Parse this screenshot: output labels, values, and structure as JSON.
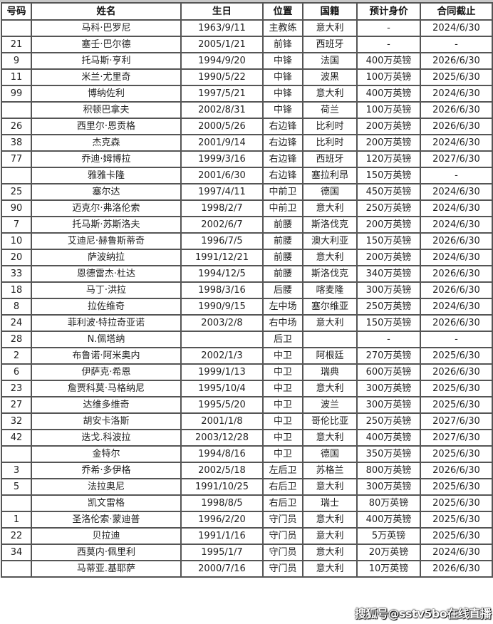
{
  "table": {
    "headers": [
      "号码",
      "姓名",
      "生日",
      "位置",
      "国籍",
      "预计身价",
      "合同截止"
    ],
    "rows": [
      [
        "",
        "马科·巴罗尼",
        "1963/9/11",
        "主教练",
        "意大利",
        "-",
        "2024/6/30"
      ],
      [
        "21",
        "塞壬·巴尔德",
        "2005/1/21",
        "前锋",
        "西班牙",
        "-",
        "-"
      ],
      [
        "9",
        "托马斯·亨利",
        "1994/9/20",
        "中锋",
        "法国",
        "400万英镑",
        "2026/6/30"
      ],
      [
        "11",
        "米兰·尤里奇",
        "1990/5/22",
        "中锋",
        "波黑",
        "100万英镑",
        "2025/6/30"
      ],
      [
        "99",
        "博纳佐利",
        "1997/5/21",
        "中锋",
        "意大利",
        "400万英镑",
        "2024/6/30"
      ],
      [
        "",
        "积顿巴拿夫",
        "2002/8/31",
        "中锋",
        "荷兰",
        "100万英镑",
        "2026/6/30"
      ],
      [
        "26",
        "西里尔·恩贡格",
        "2000/5/26",
        "右边锋",
        "比利时",
        "200万英镑",
        "2026/6/30"
      ],
      [
        "38",
        "杰克森",
        "2001/9/14",
        "右边锋",
        "比利时",
        "200万英镑",
        "2024/6/30"
      ],
      [
        "77",
        "乔迪·姆博拉",
        "1999/3/16",
        "右边锋",
        "西班牙",
        "120万英镑",
        "2027/6/30"
      ],
      [
        "",
        "雅雅卡隆",
        "2001/6/30",
        "右边锋",
        "塞拉利昂",
        "150万英镑",
        "-"
      ],
      [
        "25",
        "塞尔达",
        "1997/4/11",
        "中前卫",
        "德国",
        "450万英镑",
        "2024/6/30"
      ],
      [
        "90",
        "迈克尔·弗洛伦索",
        "1998/2/7",
        "中前卫",
        "意大利",
        "250万英镑",
        "2024/6/30"
      ],
      [
        "7",
        "托马斯·苏斯洛夫",
        "2002/6/7",
        "前腰",
        "斯洛伐克",
        "200万英镑",
        "2024/6/30"
      ],
      [
        "10",
        "艾迪尼·赫鲁斯蒂奇",
        "1996/7/5",
        "前腰",
        "澳大利亚",
        "150万英镑",
        "2026/6/30"
      ],
      [
        "20",
        "萨波纳拉",
        "1991/12/21",
        "前腰",
        "意大利",
        "200万英镑",
        "2024/6/30"
      ],
      [
        "33",
        "恩德雷杰·杜达",
        "1994/12/5",
        "前腰",
        "斯洛伐克",
        "340万英镑",
        "2026/6/30"
      ],
      [
        "18",
        "马丁·洪拉",
        "1998/3/16",
        "后腰",
        "喀麦隆",
        "300万英镑",
        "2026/6/30"
      ],
      [
        "8",
        "拉佐维奇",
        "1990/9/15",
        "左中场",
        "塞尔维亚",
        "250万英镑",
        "2024/6/30"
      ],
      [
        "24",
        "菲利波·特拉奇亚诺",
        "2003/2/8",
        "右中场",
        "意大利",
        "150万英镑",
        "2026/6/30"
      ],
      [
        "28",
        "N.佩塔纳",
        "",
        "后卫",
        "",
        "-",
        "-"
      ],
      [
        "2",
        "布鲁诺·阿米奥内",
        "2002/1/3",
        "中卫",
        "阿根廷",
        "270万英镑",
        "2025/6/30"
      ],
      [
        "6",
        "伊萨克·希恩",
        "1999/1/13",
        "中卫",
        "瑞典",
        "600万英镑",
        "2026/6/30"
      ],
      [
        "23",
        "詹贾科莫·马格纳尼",
        "1995/10/4",
        "中卫",
        "意大利",
        "300万英镑",
        "2025/6/30"
      ],
      [
        "27",
        "达维多维奇",
        "1995/5/20",
        "中卫",
        "波兰",
        "300万英镑",
        "2025/6/30"
      ],
      [
        "32",
        "胡安卡洛斯",
        "2001/1/8",
        "中卫",
        "哥伦比亚",
        "250万英镑",
        "2027/6/30"
      ],
      [
        "42",
        "迭戈.科波拉",
        "2003/12/28",
        "中卫",
        "意大利",
        "400万英镑",
        "2027/6/30"
      ],
      [
        "",
        "金特尔",
        "1994/8/16",
        "中卫",
        "德国",
        "350万英镑",
        "2025/6/30"
      ],
      [
        "3",
        "乔希·多伊格",
        "2002/5/18",
        "左后卫",
        "苏格兰",
        "800万英镑",
        "2026/6/30"
      ],
      [
        "5",
        "法拉奥尼",
        "1991/10/25",
        "右后卫",
        "意大利",
        "300万英镑",
        "2025/6/30"
      ],
      [
        "",
        "凯文雷格",
        "1998/8/5",
        "右后卫",
        "瑞士",
        "80万英镑",
        "2025/6/30"
      ],
      [
        "1",
        "圣洛伦索·蒙迪普",
        "1996/2/20",
        "守门员",
        "意大利",
        "400万英镑",
        "2025/6/30"
      ],
      [
        "22",
        "贝拉迪",
        "1991/1/16",
        "守门员",
        "意大利",
        "5万英镑",
        "2025/6/30"
      ],
      [
        "34",
        "西莫内·佩里利",
        "1995/1/7",
        "守门员",
        "意大利",
        "20万英镑",
        "2024/6/30"
      ],
      [
        "",
        "马蒂亚.基耶萨",
        "2000/7/16",
        "守门员",
        "意大利",
        "10万英镑",
        "2026/6/30"
      ]
    ]
  },
  "watermark": "搜狐号@sstv5bo在线直播"
}
